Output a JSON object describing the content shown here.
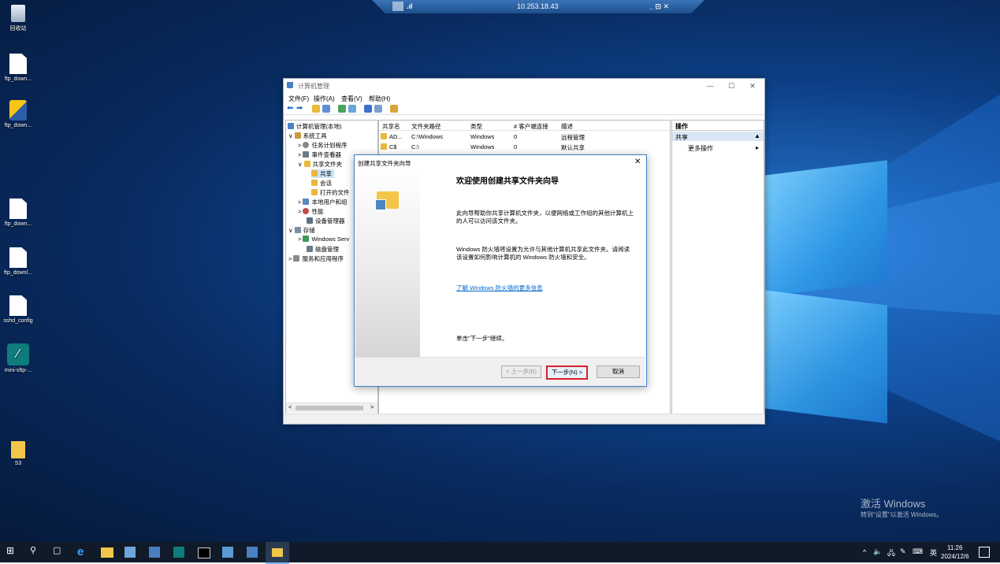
{
  "rdp_bar": {
    "address": "10.253.18.43",
    "controls": "_ ⊡ ✕"
  },
  "desktop_icons": [
    {
      "label": "回收站"
    },
    {
      "label": "ftp_down..."
    },
    {
      "label": "ftp_down..."
    },
    {
      "label": "ftp_down..."
    },
    {
      "label": "ftp_downl..."
    },
    {
      "label": "sshd_config"
    },
    {
      "label": "mini-sftp-..."
    },
    {
      "label": "S3"
    }
  ],
  "window": {
    "title": "计算机管理",
    "menus": [
      "文件(F)",
      "操作(A)",
      "查看(V)",
      "帮助(H)"
    ],
    "tree": [
      {
        "label": "计算机管理(本地)",
        "arrow": ""
      },
      {
        "label": "系统工具",
        "arrow": "∨"
      },
      {
        "label": "任务计划程序",
        "arrow": ">"
      },
      {
        "label": "事件查看器",
        "arrow": ">"
      },
      {
        "label": "共享文件夹",
        "arrow": "∨"
      },
      {
        "label": "共享",
        "arrow": ""
      },
      {
        "label": "会话",
        "arrow": ""
      },
      {
        "label": "打开的文件",
        "arrow": ""
      },
      {
        "label": "本地用户和组",
        "arrow": ">"
      },
      {
        "label": "性能",
        "arrow": ">"
      },
      {
        "label": "设备管理器",
        "arrow": ""
      },
      {
        "label": "存储",
        "arrow": "∨"
      },
      {
        "label": "Windows Serv",
        "arrow": ">"
      },
      {
        "label": "磁盘管理",
        "arrow": ""
      },
      {
        "label": "服务和应用程序",
        "arrow": ">"
      }
    ],
    "columns": [
      "共享名",
      "文件夹路径",
      "类型",
      "# 客户端连接",
      "描述"
    ],
    "rows": [
      [
        "AD...",
        "C:\\Windows",
        "Windows",
        "0",
        "远程管理"
      ],
      [
        "C$",
        "C:\\",
        "Windows",
        "0",
        "默认共享"
      ]
    ],
    "actions": {
      "header": "操作",
      "section": "共享",
      "more": "更多操作"
    }
  },
  "wizard": {
    "title": "创建共享文件夹向导",
    "heading": "欢迎使用创建共享文件夹向导",
    "para1": "此向导帮助你共享计算机文件夹，以便网络或工作组的其他计算机上的人可以访问该文件夹。",
    "para2": "Windows 防火墙将设置为允许与其他计算机共享此文件夹。请阅读该设置如何影响计算机的 Windows 防火墙和安全。",
    "link": "了解 Windows 防火墙的更多信息",
    "continue": "单击\"下一步\"继续。",
    "back": "< 上一步(B)",
    "next": "下一步(N) >",
    "cancel": "取消"
  },
  "watermark": {
    "line1": "激活 Windows",
    "line2": "转到\"设置\"以激活 Windows。"
  },
  "tray": {
    "time": "11:26",
    "date": "2024/12/6",
    "ime": "英"
  }
}
